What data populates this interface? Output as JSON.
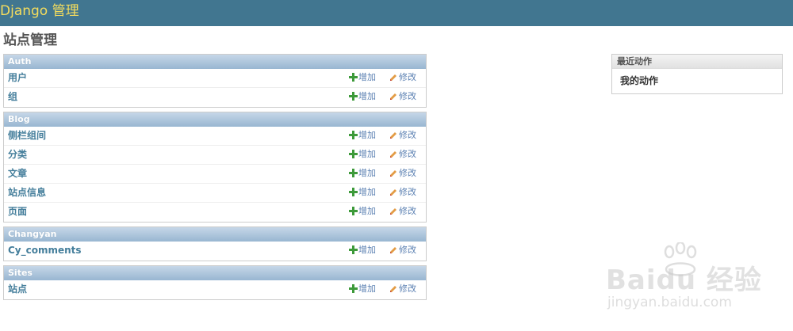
{
  "header": {
    "branding": "Django 管理"
  },
  "page": {
    "title": "站点管理"
  },
  "modules": [
    {
      "caption": "Auth",
      "models": [
        {
          "name": "用户",
          "add": "增加",
          "change": "修改"
        },
        {
          "name": "组",
          "add": "增加",
          "change": "修改"
        }
      ]
    },
    {
      "caption": "Blog",
      "models": [
        {
          "name": "侧栏组间",
          "add": "增加",
          "change": "修改"
        },
        {
          "name": "分类",
          "add": "增加",
          "change": "修改"
        },
        {
          "name": "文章",
          "add": "增加",
          "change": "修改"
        },
        {
          "name": "站点信息",
          "add": "增加",
          "change": "修改"
        },
        {
          "name": "页面",
          "add": "增加",
          "change": "修改"
        }
      ]
    },
    {
      "caption": "Changyan",
      "models": [
        {
          "name": "Cy_comments",
          "add": "增加",
          "change": "修改"
        }
      ]
    },
    {
      "caption": "Sites",
      "models": [
        {
          "name": "站点",
          "add": "增加",
          "change": "修改"
        }
      ]
    }
  ],
  "recent_actions": {
    "title": "最近动作",
    "my_actions": "我的动作"
  },
  "watermark": {
    "main": "Baidu 经验",
    "sub": "jingyan.baidu.com"
  },
  "colors": {
    "header_bg": "#417690",
    "branding": "#f5dd5d",
    "link": "#447e9b",
    "caption_bg": "#98b6d1"
  },
  "icons": {
    "add": "plus-icon",
    "change": "pencil-icon"
  }
}
